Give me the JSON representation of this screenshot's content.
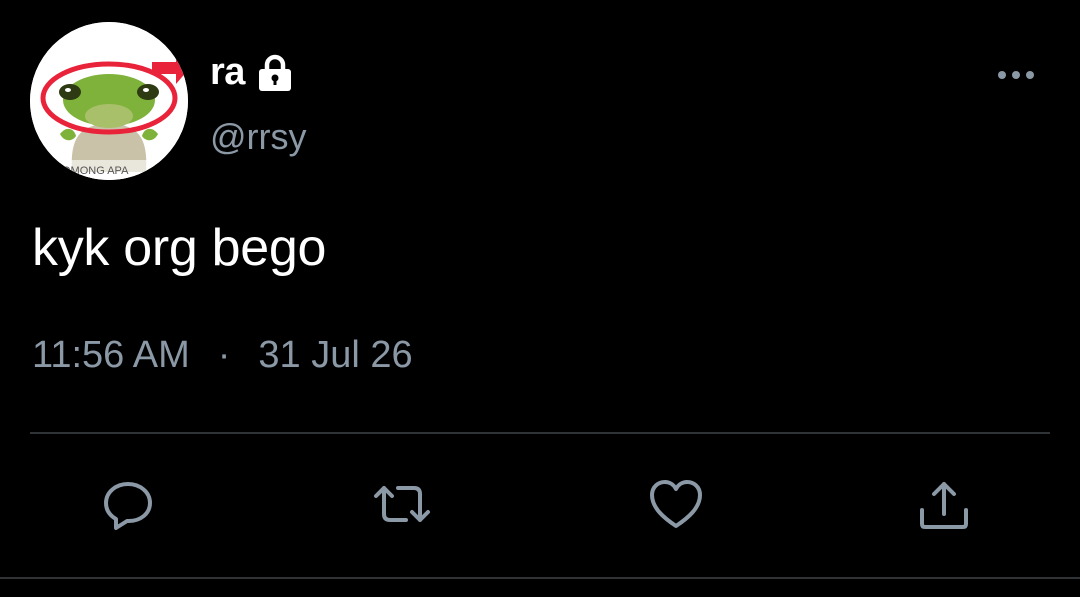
{
  "tweet": {
    "author": {
      "display_name": "ra",
      "handle": "@rrsy",
      "avatar_caption": "OMONG APA",
      "protected_icon": "lock-icon"
    },
    "text": "kyk org bego",
    "time": "11:56 AM",
    "separator": "·",
    "date": "31 Jul 26"
  },
  "actions": [
    {
      "name": "reply",
      "icon": "reply-icon"
    },
    {
      "name": "retweet",
      "icon": "retweet-icon"
    },
    {
      "name": "like",
      "icon": "heart-icon"
    },
    {
      "name": "share",
      "icon": "share-icon"
    }
  ],
  "colors": {
    "background": "#000000",
    "primary_text": "#ffffff",
    "secondary_text": "#8b98a5",
    "divider": "#2f3336",
    "avatar_accent": "#e8233a",
    "avatar_frog": "#7fb23a"
  }
}
